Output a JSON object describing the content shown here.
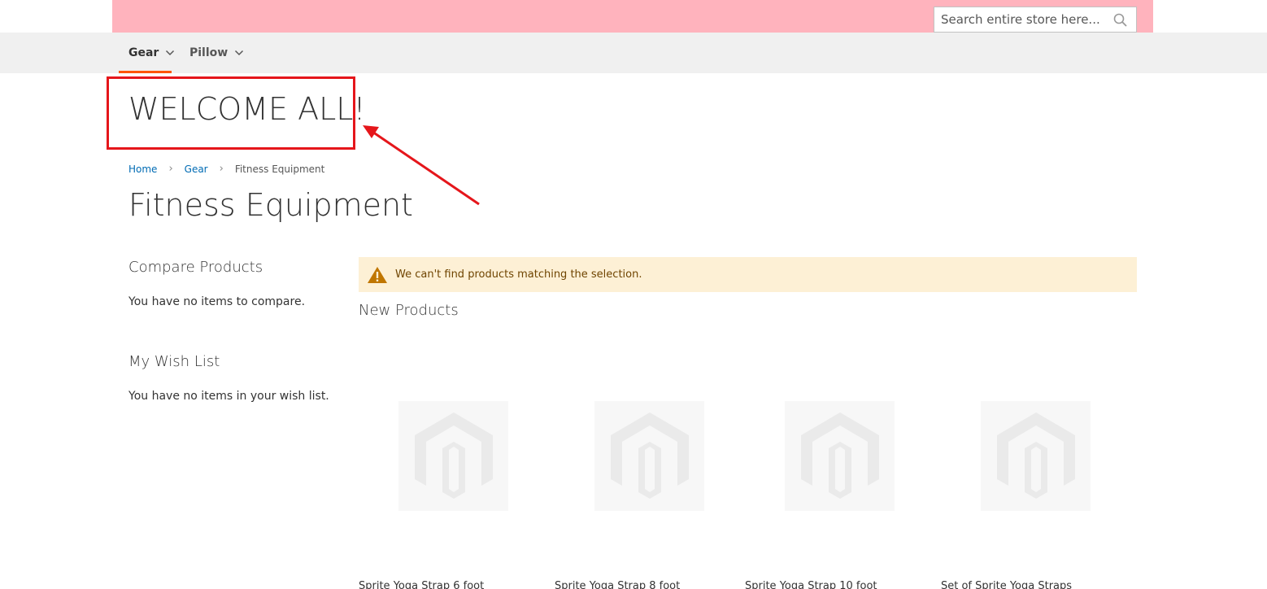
{
  "header": {
    "search_placeholder": "Search entire store here...",
    "colors": {
      "topbar": "#ffb3bd",
      "nav_bg": "#f0f0f0",
      "nav_active_underline": "#ff5501"
    }
  },
  "nav": {
    "items": [
      {
        "label": "Gear",
        "active": true
      },
      {
        "label": "Pillow",
        "active": false
      }
    ]
  },
  "welcome": {
    "text": "WELCOME ALL!"
  },
  "breadcrumb": {
    "items": [
      {
        "label": "Home"
      },
      {
        "label": "Gear"
      },
      {
        "label": "Fitness Equipment"
      }
    ]
  },
  "page_title": "Fitness Equipment",
  "sidebar": {
    "compare_title": "Compare Products",
    "compare_text": "You have no items to compare.",
    "wishlist_title": "My Wish List",
    "wishlist_text": "You have no items in your wish list."
  },
  "notice": {
    "message": "We can't find products matching the selection.",
    "icon": "warning-icon"
  },
  "new_products": {
    "title": "New Products",
    "items": [
      {
        "name": "Sprite Yoga Strap 6 foot"
      },
      {
        "name": "Sprite Yoga Strap 8 foot"
      },
      {
        "name": "Sprite Yoga Strap 10 foot"
      },
      {
        "name": "Set of Sprite Yoga Straps"
      }
    ]
  },
  "annotation": {
    "color": "#e5161b"
  }
}
